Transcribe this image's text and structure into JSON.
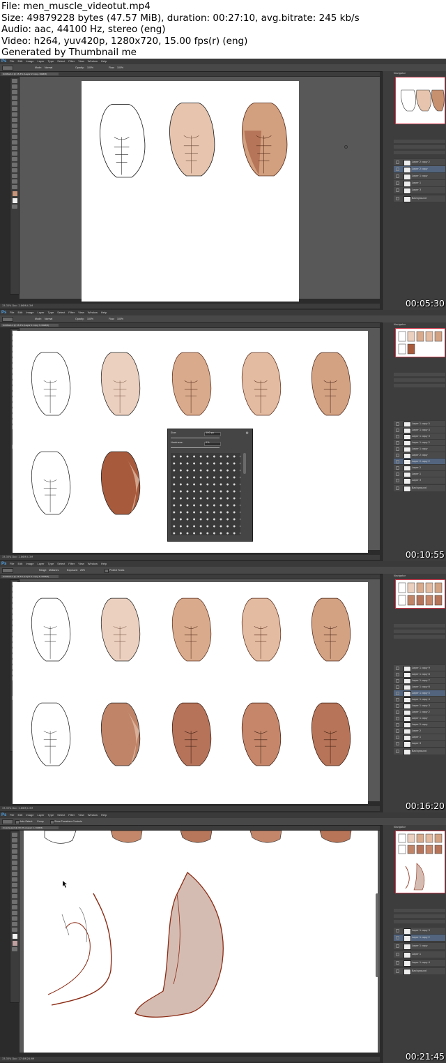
{
  "header": {
    "file": "File: men_muscle_videotut.mp4",
    "size": "Size: 49879228 bytes (47.57 MiB), duration: 00:27:10, avg.bitrate: 245 kb/s",
    "audio": "Audio: aac, 44100 Hz, stereo (eng)",
    "video": "Video: h264, yuv420p, 1280x720, 15.00 fps(r) (eng)",
    "generator": "Generated by Thumbnail me"
  },
  "app": {
    "logo": "Ps",
    "menu": [
      "File",
      "Edit",
      "Image",
      "Layer",
      "Type",
      "Select",
      "Filter",
      "View",
      "Window",
      "Help"
    ]
  },
  "colors": {
    "ui_bg": "#2b2b2b",
    "skin_light": "#e6c4ad",
    "skin_mid": "#d2a07f",
    "skin_dark": "#a3593e",
    "lineart": "#222222",
    "lineart_red": "#8b2b14",
    "nav_border": "#d03a4c",
    "selected_layer": "#53657e"
  },
  "frames": [
    {
      "timestamp": "00:05:30",
      "tab": "Untitled-1 @ 15.3% (Layer 2 copy, RGB/8)",
      "status": "33.33%   Doc: 2.86M/4.3M",
      "options": [
        "Mode:",
        "Normal",
        "Opacity:",
        "100%",
        "Flow:",
        "100%"
      ],
      "layers": [
        "Layer 2 copy 2",
        "Layer 2 copy",
        "Layer 1 copy",
        "Layer 1",
        "Layer 3",
        "Background"
      ],
      "selected_layer": 1
    },
    {
      "timestamp": "00:10:55",
      "tab": "Untitled-1 @ 15.3% (Layer 1 copy 3, RGB/8)",
      "status": "33.33%   Doc: 2.86M/4.3M",
      "options": [
        "Mode:",
        "Normal",
        "Opacity:",
        "100%",
        "Flow:",
        "100%"
      ],
      "brush_panel": {
        "size_label": "Size:",
        "size_value": "100 px",
        "hardness_label": "Hardness:",
        "hardness_value": "0%"
      },
      "layers": [
        "Layer 1 copy 5",
        "Layer 1 copy 4",
        "Layer 1 copy 3",
        "Layer 1 copy 2",
        "Layer 1 copy",
        "Layer 2 copy",
        "Layer 2 copy 2",
        "Layer 2",
        "Layer 1",
        "Layer 3",
        "Background"
      ],
      "selected_layer": 6
    },
    {
      "timestamp": "00:16:20",
      "tab": "Untitled-1 @ 15.3% (Layer 1 copy 5, RGB/8)",
      "status": "33.33%   Doc: 2.86M/4.3M",
      "options": [
        "Range:",
        "Midtones",
        "Exposure:",
        "25%",
        "Protect Tones"
      ],
      "layers": [
        "Layer 1 copy 9",
        "Layer 1 copy 8",
        "Layer 1 copy 7",
        "Layer 1 copy 6",
        "Layer 1 copy 5",
        "Layer 1 copy 4",
        "Layer 1 copy 3",
        "Layer 1 copy 2",
        "Layer 1 copy",
        "Layer 2 copy",
        "Layer 2",
        "Layer 1",
        "Layer 3",
        "Background"
      ],
      "selected_layer": 4
    },
    {
      "timestamp": "00:21:45",
      "tab": "muscle.psd @ 33.3% (Layer 1, RGB/8)",
      "status": "33.33%   Doc: 27.4M/28.9M",
      "options": [
        "Auto-Select:",
        "Group",
        "Show Transform Controls"
      ],
      "layers": [
        "Layer 1 copy 3",
        "Layer 1 copy 2",
        "Layer 1 copy",
        "Layer 1",
        "Layer 1 copy 4",
        "Background"
      ],
      "selected_layer": 1
    }
  ]
}
